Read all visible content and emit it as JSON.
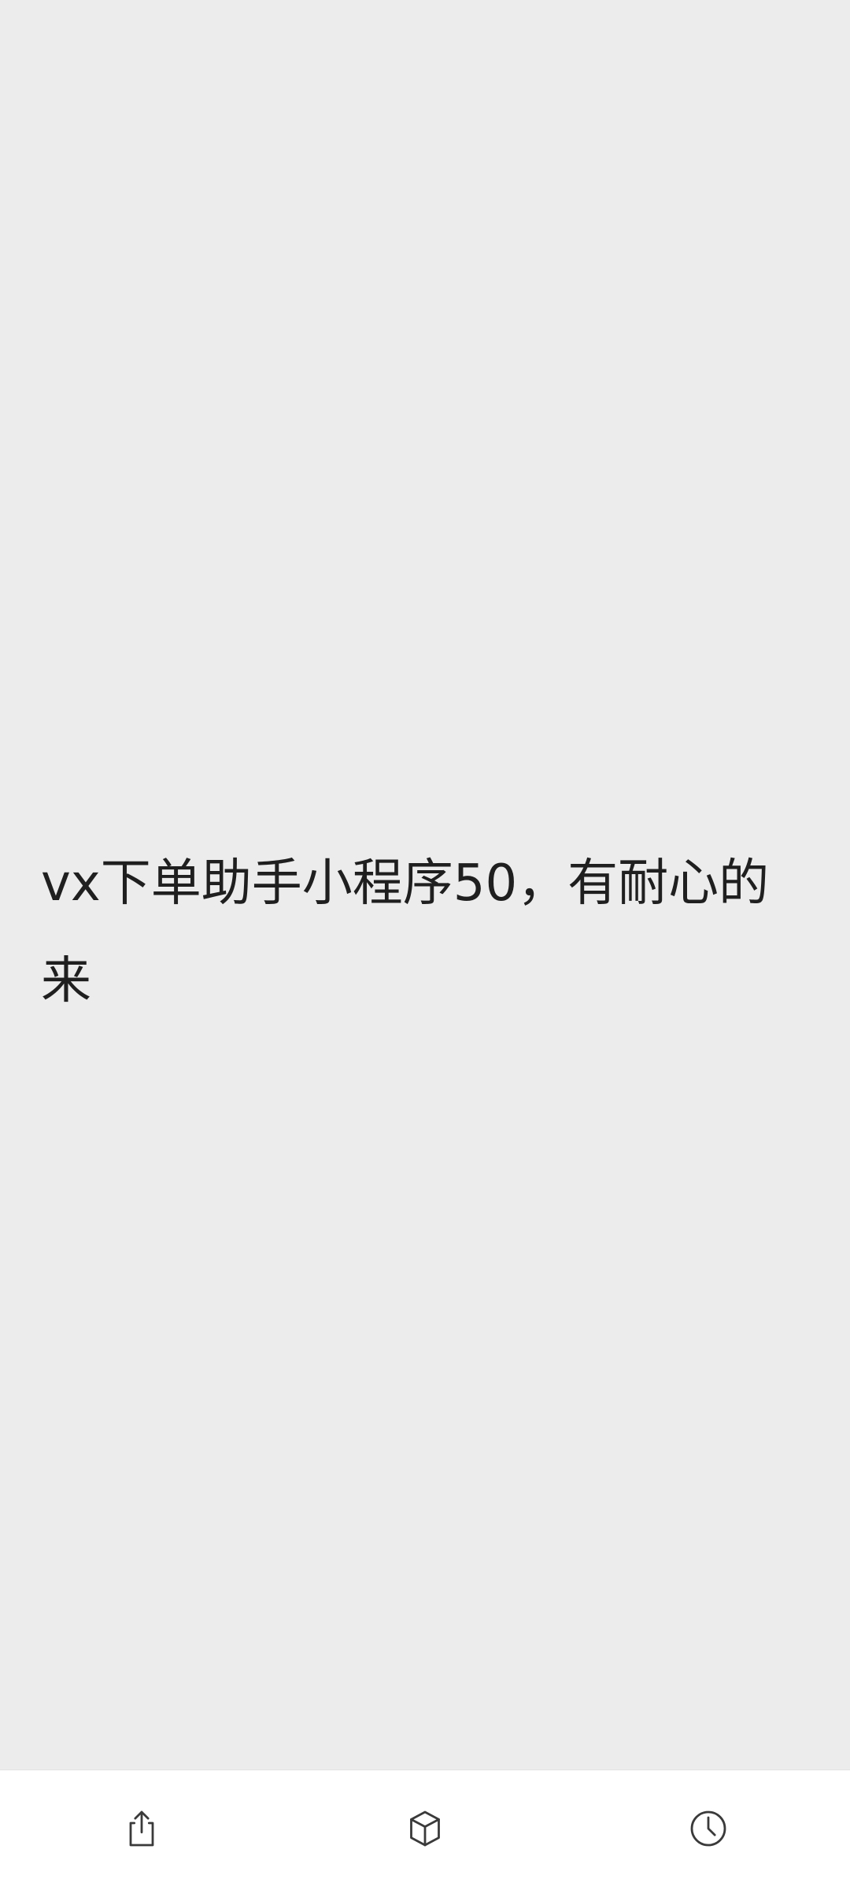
{
  "message": {
    "text": "vx下单助手小程序50，有耐心的来"
  },
  "bottom_bar": {
    "items": [
      {
        "name": "share",
        "icon": "share-icon"
      },
      {
        "name": "package",
        "icon": "cube-icon"
      },
      {
        "name": "history",
        "icon": "clock-icon"
      }
    ]
  },
  "colors": {
    "background": "#ececec",
    "text": "#1f1f1f",
    "bar_background": "#ffffff",
    "icon": "#3a3a3a"
  }
}
